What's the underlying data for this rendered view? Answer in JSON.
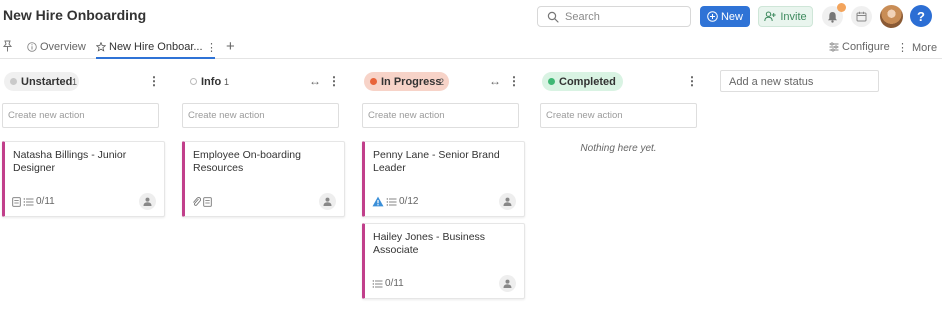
{
  "app": {
    "title": "New Hire Onboarding"
  },
  "search": {
    "placeholder": "Search"
  },
  "buttons": {
    "new_label": "New",
    "invite_label": "Invite",
    "help_label": "?"
  },
  "colors": {
    "accent": "#2f73d6",
    "card_stripe": "#c13f8b",
    "invite_green": "#3d8a5e"
  },
  "tabs": [
    {
      "label": "Overview",
      "icon": "info-circle-icon"
    },
    {
      "label": "New Hire Onboar...",
      "icon": "star-outline-icon",
      "active": true
    }
  ],
  "toolbar": {
    "configure_label": "Configure",
    "more_label": "More"
  },
  "columns": [
    {
      "label": "Unstarted",
      "count": "1",
      "dot_color": "#c9c9c9",
      "pill_bg": "#f0f0f0",
      "new_action_placeholder": "Create new action",
      "cards": [
        {
          "title": "Natasha Billings - Junior Designer",
          "checklist": "0/11"
        }
      ]
    },
    {
      "label": "Info",
      "count": "1",
      "dot_color": "#ffffff",
      "pill_bg": "#ffffff",
      "new_action_placeholder": "Create new action",
      "cards": [
        {
          "title": "Employee On-boarding Resources",
          "checklist": ""
        }
      ]
    },
    {
      "label": "In Progress",
      "count": "2",
      "dot_color": "#e8643a",
      "pill_bg": "#f7d3c8",
      "new_action_placeholder": "Create new action",
      "cards": [
        {
          "title": "Penny Lane - Senior Brand Leader",
          "checklist": "0/12"
        },
        {
          "title": "Hailey Jones - Business Associate",
          "checklist": "0/11"
        }
      ]
    },
    {
      "label": "Completed",
      "count": "",
      "dot_color": "#3fb774",
      "pill_bg": "#d9f3e3",
      "new_action_placeholder": "Create new action",
      "empty_text": "Nothing here yet.",
      "cards": []
    }
  ],
  "add_status": {
    "placeholder": "Add a new status"
  }
}
